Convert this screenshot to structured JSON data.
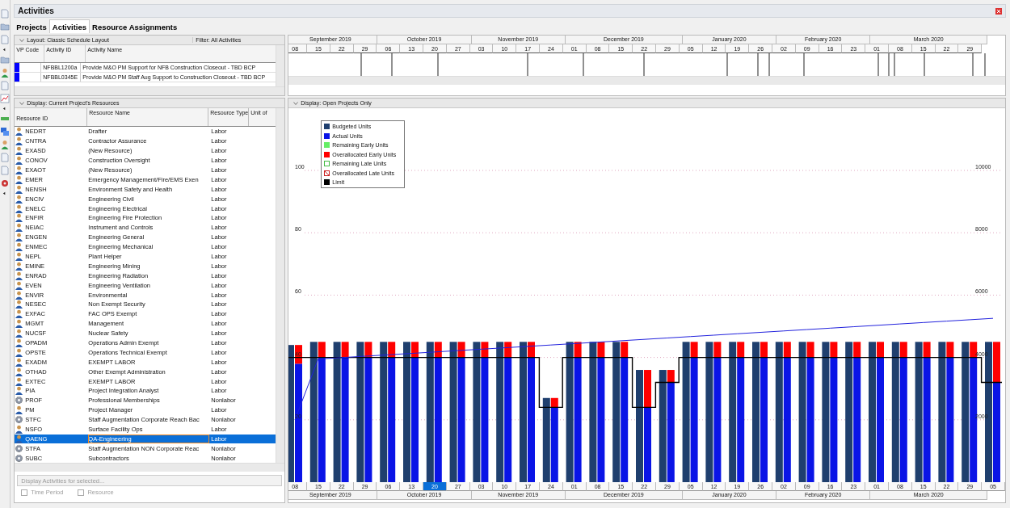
{
  "window": {
    "title": "Activities"
  },
  "tabs": [
    {
      "label": "Projects",
      "selected": false
    },
    {
      "label": "Activities",
      "selected": true
    },
    {
      "label": "Resource Assignments",
      "selected": false
    }
  ],
  "activities": {
    "layout": "Layout: Classic Schedule Layout",
    "filter": "Filter: All Activities",
    "columns": [
      "VP Code",
      "Activity ID",
      "Activity Name"
    ],
    "rows": [
      {
        "id": "NFBBL1200a",
        "name": "Provide M&O PM Support for NFB Construction Closeout - TBD BCP"
      },
      {
        "id": "NFBBL0345E",
        "name": "Provide M&O PM Staff Aug Support to Construction Closeout - TBD BCP"
      }
    ]
  },
  "gantt": {
    "months": [
      {
        "label": "September 2019",
        "weeks": [
          "08",
          "15",
          "22",
          "29"
        ]
      },
      {
        "label": "October 2019",
        "weeks": [
          "06",
          "13",
          "20",
          "27"
        ]
      },
      {
        "label": "November 2019",
        "weeks": [
          "03",
          "10",
          "17",
          "24"
        ]
      },
      {
        "label": "December 2019",
        "weeks": [
          "01",
          "08",
          "15",
          "22",
          "29"
        ]
      },
      {
        "label": "January 2020",
        "weeks": [
          "05",
          "12",
          "19",
          "26"
        ]
      },
      {
        "label": "February 2020",
        "weeks": [
          "02",
          "09",
          "16",
          "23"
        ]
      },
      {
        "label": "March 2020",
        "weeks": [
          "01",
          "08",
          "15",
          "22",
          "29"
        ]
      }
    ]
  },
  "resources": {
    "display": "Display: Current Project's Resources",
    "columns": [
      "Resource ID",
      "Resource Name",
      "Resource Type",
      "Unit of"
    ],
    "rows": [
      {
        "kind": "labor",
        "id": "NEDRT",
        "name": "Drafter",
        "type": "Labor",
        "selected": false
      },
      {
        "kind": "labor",
        "id": "CNTRA",
        "name": "Contractor Assurance",
        "type": "Labor",
        "selected": false
      },
      {
        "kind": "labor",
        "id": "EXASD",
        "name": "(New Resource)",
        "type": "Labor",
        "selected": false
      },
      {
        "kind": "labor",
        "id": "CONOV",
        "name": "Construction Oversight",
        "type": "Labor",
        "selected": false
      },
      {
        "kind": "labor",
        "id": "EXAOT",
        "name": "(New Resource)",
        "type": "Labor",
        "selected": false
      },
      {
        "kind": "labor",
        "id": "EMER",
        "name": "Emergency Management/Fire/EMS Exen",
        "type": "Labor",
        "selected": false
      },
      {
        "kind": "labor",
        "id": "NENSH",
        "name": "Environment Safety and Health",
        "type": "Labor",
        "selected": false
      },
      {
        "kind": "labor",
        "id": "ENCIV",
        "name": "Engineering Civil",
        "type": "Labor",
        "selected": false
      },
      {
        "kind": "labor",
        "id": "ENELC",
        "name": "Engineering Electrical",
        "type": "Labor",
        "selected": false
      },
      {
        "kind": "labor",
        "id": "ENFIR",
        "name": "Engineering Fire Protection",
        "type": "Labor",
        "selected": false
      },
      {
        "kind": "labor",
        "id": "NEIAC",
        "name": "Instrument and Controls",
        "type": "Labor",
        "selected": false
      },
      {
        "kind": "labor",
        "id": "ENGEN",
        "name": "Engineering General",
        "type": "Labor",
        "selected": false
      },
      {
        "kind": "labor",
        "id": "ENMEC",
        "name": "Engineering Mechanical",
        "type": "Labor",
        "selected": false
      },
      {
        "kind": "labor",
        "id": "NEPL",
        "name": "Plant Helper",
        "type": "Labor",
        "selected": false
      },
      {
        "kind": "labor",
        "id": "EMINE",
        "name": "Engineering Mining",
        "type": "Labor",
        "selected": false
      },
      {
        "kind": "labor",
        "id": "ENRAD",
        "name": "Engineering Radiation",
        "type": "Labor",
        "selected": false
      },
      {
        "kind": "labor",
        "id": "EVEN",
        "name": "Engineering Ventilation",
        "type": "Labor",
        "selected": false
      },
      {
        "kind": "labor",
        "id": "ENVIR",
        "name": "Environmental",
        "type": "Labor",
        "selected": false
      },
      {
        "kind": "labor",
        "id": "NESEC",
        "name": "Non Exempt Security",
        "type": "Labor",
        "selected": false
      },
      {
        "kind": "labor",
        "id": "EXFAC",
        "name": "FAC OPS Exempt",
        "type": "Labor",
        "selected": false
      },
      {
        "kind": "labor",
        "id": "MGMT",
        "name": "Management",
        "type": "Labor",
        "selected": false
      },
      {
        "kind": "labor",
        "id": "NUCSF",
        "name": "Nuclear Safety",
        "type": "Labor",
        "selected": false
      },
      {
        "kind": "labor",
        "id": "OPADM",
        "name": "Operations Admin Exempt",
        "type": "Labor",
        "selected": false
      },
      {
        "kind": "labor",
        "id": "OPSTE",
        "name": "Operations Technical Exempt",
        "type": "Labor",
        "selected": false
      },
      {
        "kind": "labor",
        "id": "EXADM",
        "name": "EXEMPT LABOR",
        "type": "Labor",
        "selected": false
      },
      {
        "kind": "labor",
        "id": "OTHAD",
        "name": "Other Exempt Administration",
        "type": "Labor",
        "selected": false
      },
      {
        "kind": "labor",
        "id": "EXTEC",
        "name": "EXEMPT LABOR",
        "type": "Labor",
        "selected": false
      },
      {
        "kind": "labor",
        "id": "PIA",
        "name": "Project Integration Analyst",
        "type": "Labor",
        "selected": false
      },
      {
        "kind": "nonlabor",
        "id": "PROF",
        "name": "Professional Memberships",
        "type": "Nonlabor",
        "selected": false
      },
      {
        "kind": "labor",
        "id": "PM",
        "name": "Project Manager",
        "type": "Labor",
        "selected": false
      },
      {
        "kind": "nonlabor",
        "id": "STFC",
        "name": "Staff Augmentation Corporate Reach Bac",
        "type": "Nonlabor",
        "selected": false
      },
      {
        "kind": "labor",
        "id": "NSFO",
        "name": "Surface Facility Ops",
        "type": "Labor",
        "selected": false
      },
      {
        "kind": "labor",
        "id": "QAENG",
        "name": "QA-Engineering",
        "type": "Labor",
        "selected": true
      },
      {
        "kind": "nonlabor",
        "id": "STFA",
        "name": "Staff Augmentation NON Corporate Reac",
        "type": "Nonlabor",
        "selected": false
      },
      {
        "kind": "nonlabor",
        "id": "SUBC",
        "name": "Subcontractors",
        "type": "Nonlabor",
        "selected": false
      }
    ],
    "button": {
      "label": "Display Activities for selected...",
      "disabled": true
    },
    "options": [
      {
        "label": "Time Period",
        "checked": false,
        "disabled": true
      },
      {
        "label": "Resource",
        "checked": false,
        "disabled": true
      }
    ]
  },
  "chart": {
    "display": "Display: Open Projects Only",
    "legend": [
      {
        "label": "Budgeted Units",
        "color": "#1f3f6e",
        "kind": "solid"
      },
      {
        "label": "Actual Units",
        "color": "#0a14e6",
        "kind": "solid"
      },
      {
        "label": "Remaining Early Units",
        "color": "#66ee66",
        "kind": "solid"
      },
      {
        "label": "Overallocated Early Units",
        "color": "#ff0000",
        "kind": "solid"
      },
      {
        "label": "Remaining Late Units",
        "color": "#44bb44",
        "kind": "outline"
      },
      {
        "label": "Overallocated Late Units",
        "color": "#cc2222",
        "kind": "hatched"
      },
      {
        "label": "Limit",
        "color": "#000000",
        "kind": "solid"
      }
    ],
    "y_ticks": [
      "100",
      "80",
      "60",
      "40",
      "20"
    ],
    "y2_ticks": [
      "10000",
      "8000",
      "6000",
      "4000",
      "2000"
    ],
    "weeks": [
      {
        "label": "08",
        "selected": false
      },
      {
        "label": "15",
        "selected": false
      },
      {
        "label": "22",
        "selected": false
      },
      {
        "label": "29",
        "selected": false
      },
      {
        "label": "06",
        "selected": false
      },
      {
        "label": "13",
        "selected": false
      },
      {
        "label": "20",
        "selected": true
      },
      {
        "label": "27",
        "selected": false
      },
      {
        "label": "03",
        "selected": false
      },
      {
        "label": "10",
        "selected": false
      },
      {
        "label": "17",
        "selected": false
      },
      {
        "label": "24",
        "selected": false
      },
      {
        "label": "01",
        "selected": false
      },
      {
        "label": "08",
        "selected": false
      },
      {
        "label": "15",
        "selected": false
      },
      {
        "label": "22",
        "selected": false
      },
      {
        "label": "29",
        "selected": false
      },
      {
        "label": "05",
        "selected": false
      },
      {
        "label": "12",
        "selected": false
      },
      {
        "label": "19",
        "selected": false
      },
      {
        "label": "26",
        "selected": false
      },
      {
        "label": "02",
        "selected": false
      },
      {
        "label": "09",
        "selected": false
      },
      {
        "label": "16",
        "selected": false
      },
      {
        "label": "23",
        "selected": false
      },
      {
        "label": "01",
        "selected": false
      },
      {
        "label": "08",
        "selected": false
      },
      {
        "label": "15",
        "selected": false
      },
      {
        "label": "22",
        "selected": false
      },
      {
        "label": "29",
        "selected": false
      },
      {
        "label": "05",
        "selected": false
      }
    ],
    "axis_months": [
      "September 2019",
      "October 2019",
      "November 2019",
      "December 2019",
      "January 2020",
      "February 2020",
      "March 2020"
    ]
  }
}
